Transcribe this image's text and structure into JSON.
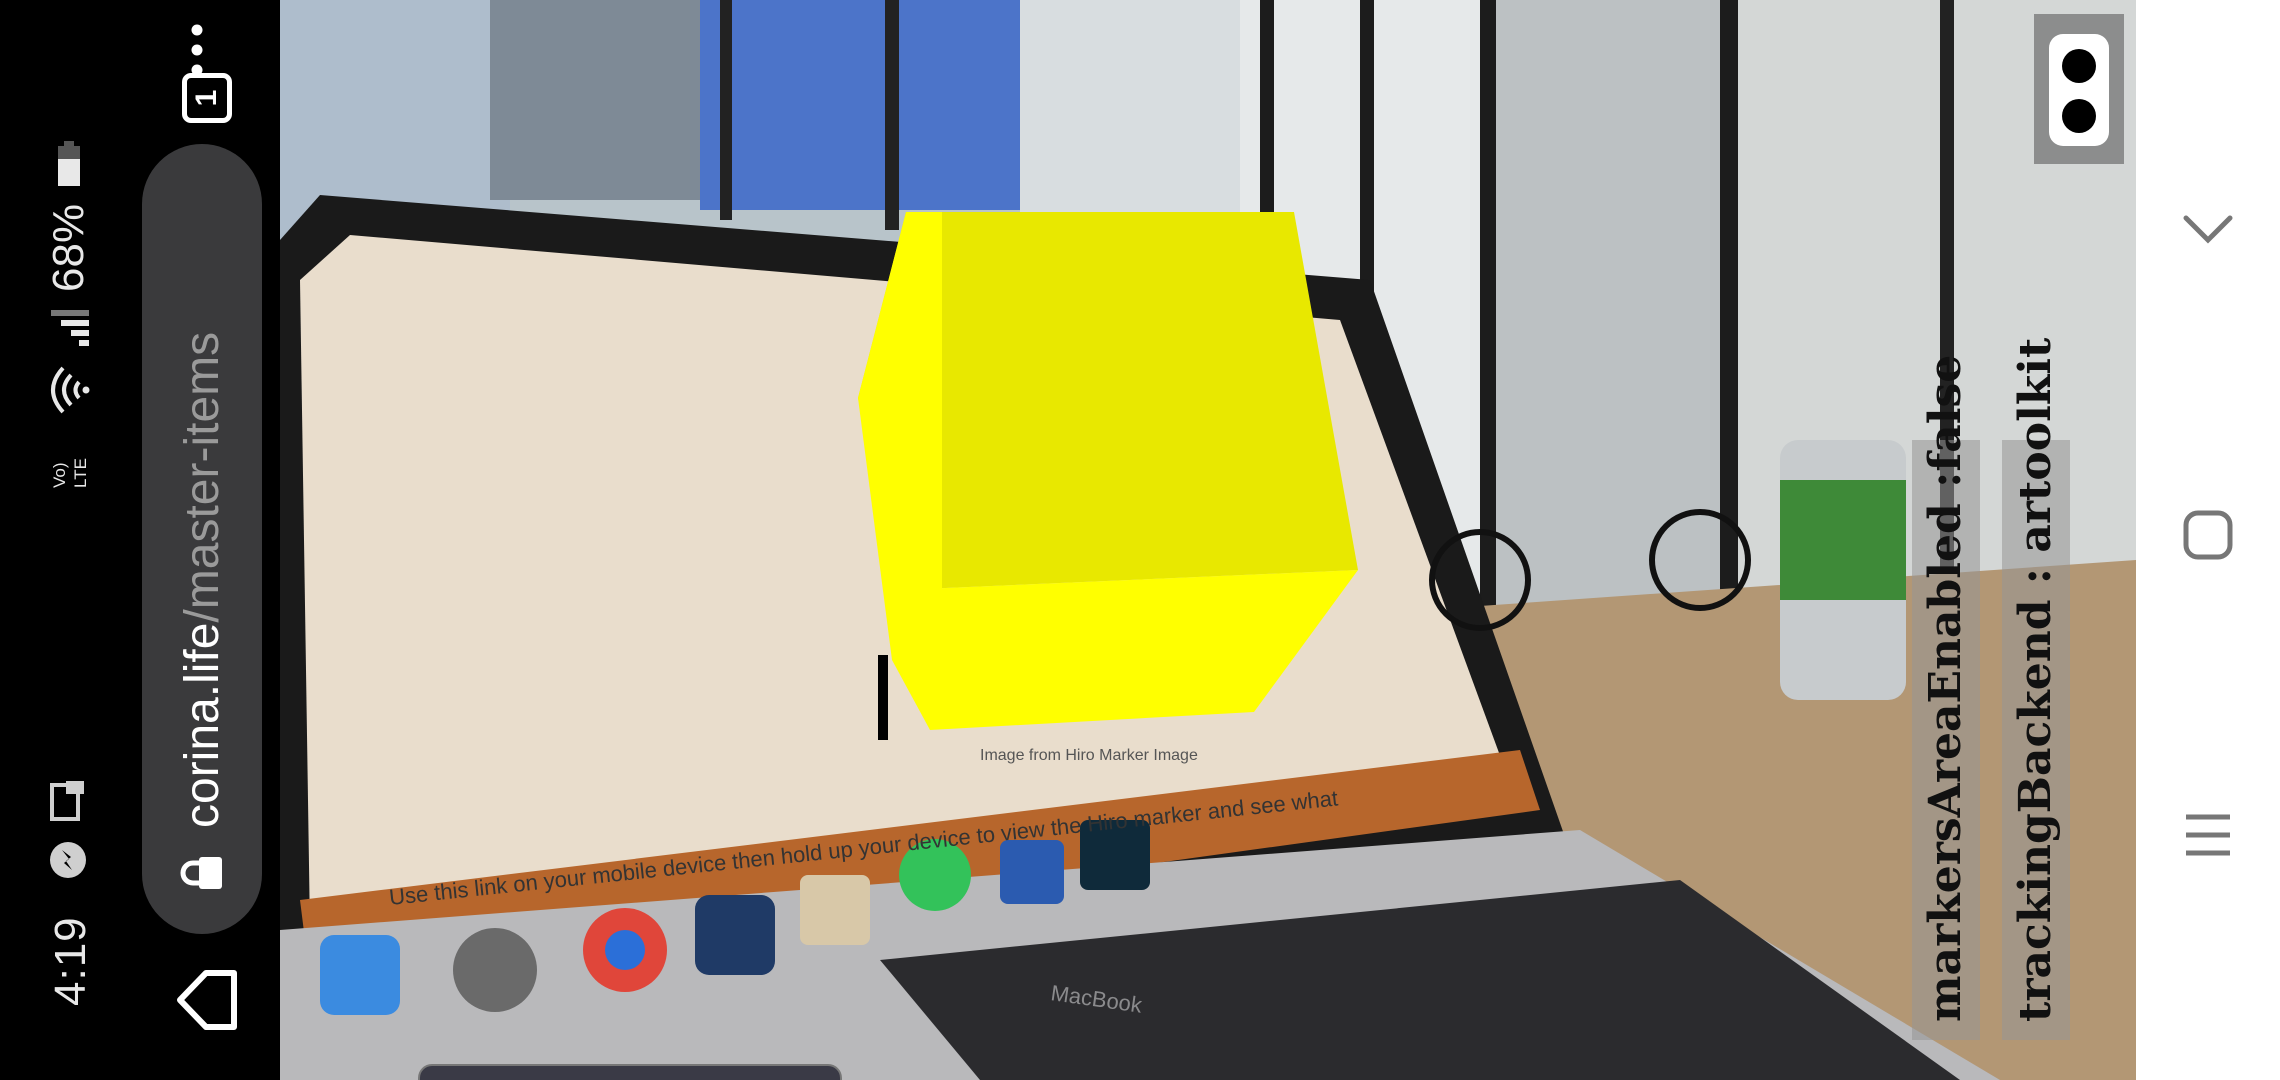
{
  "status_bar": {
    "time": "4:19",
    "battery": "68%",
    "network": "Vo) LTE",
    "icons": [
      "messenger-icon",
      "screen-mirror-icon",
      "wifi-icon",
      "signal-icon",
      "battery-icon"
    ]
  },
  "browser": {
    "url_host": "corina.life",
    "url_path": "/master-items",
    "tab_count": "1",
    "menu_glyph": "•••"
  },
  "ar_scene": {
    "object": "yellow-cube",
    "cube_color": "#ffff00",
    "laptop_screen_text": "Image from Hiro Marker Image",
    "laptop_instruction": "Use this link on your mobile device then hold up your device to view the Hiro marker and see what",
    "laptop_brand": "MacBook"
  },
  "info": {
    "markers_area": "markersAreaEnabled :false",
    "tracking_backend": "trackingBackend : artoolkit"
  },
  "navigation": {
    "buttons": [
      "back-icon",
      "home-icon",
      "recents-icon"
    ]
  },
  "colors": {
    "cube_top": "#e8e800",
    "cube_front": "#ffff00",
    "status_bg": "#000000",
    "nav_bg": "#ffffff"
  }
}
